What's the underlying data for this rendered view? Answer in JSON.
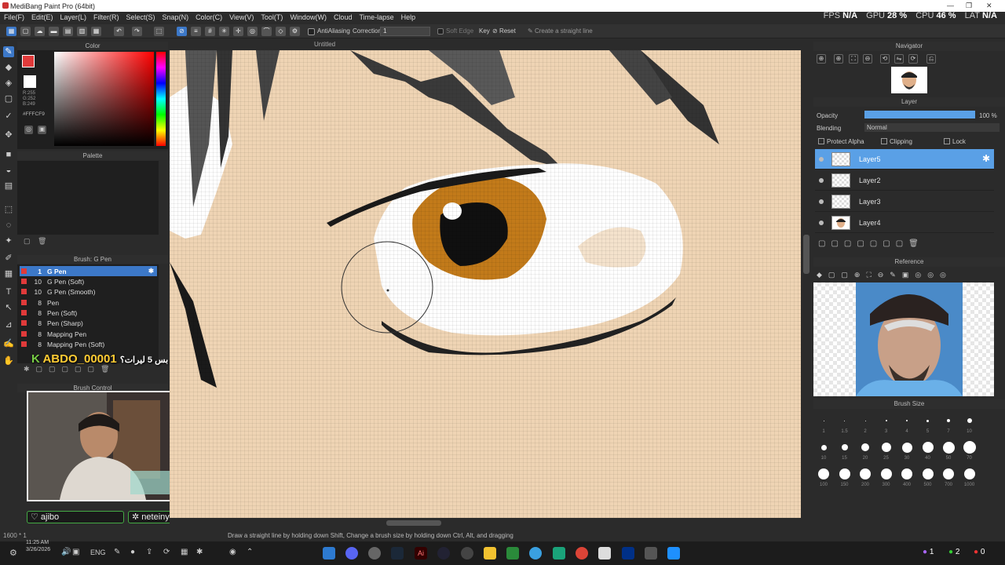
{
  "window": {
    "title": "MediBang Paint Pro (64bit)"
  },
  "menu": [
    "File(F)",
    "Edit(E)",
    "Layer(L)",
    "Filter(R)",
    "Select(S)",
    "Snap(N)",
    "Color(C)",
    "View(V)",
    "Tool(T)",
    "Window(W)",
    "Cloud",
    "Time-lapse",
    "Help"
  ],
  "perf": {
    "fps_label": "FPS",
    "fps": "N/A",
    "gpu_label": "GPU",
    "gpu": "28 %",
    "cpu_label": "CPU",
    "cpu": "46 %",
    "lat_label": "LAT",
    "lat": "N/A"
  },
  "toolbar": {
    "antialias": "AntiAliasing",
    "correction_label": "Correction",
    "correction_value": "1",
    "soft_edge": "Soft Edge",
    "key": "Key",
    "reset": "Reset",
    "straight": "Create a straight line"
  },
  "document": {
    "name": "Untitled"
  },
  "color_panel": {
    "title": "Color",
    "primary": "#e03a3a",
    "secondary": "#ffffff",
    "r": "R:255",
    "g": "G:252",
    "b": "B:249",
    "hex": "#FFFCF9"
  },
  "palette_panel": {
    "title": "Palette"
  },
  "brush_panel": {
    "title": "Brush: G Pen",
    "items": [
      {
        "size": "1",
        "name": "G Pen"
      },
      {
        "size": "10",
        "name": "G Pen (Soft)"
      },
      {
        "size": "10",
        "name": "G Pen (Smooth)"
      },
      {
        "size": "8",
        "name": "Pen"
      },
      {
        "size": "8",
        "name": "Pen (Soft)"
      },
      {
        "size": "8",
        "name": "Pen (Sharp)"
      },
      {
        "size": "8",
        "name": "Mapping Pen"
      },
      {
        "size": "8",
        "name": "Mapping Pen (Soft)"
      }
    ]
  },
  "brush_control": {
    "title": "Brush Control"
  },
  "navigator": {
    "title": "Navigator"
  },
  "layer_panel": {
    "title": "Layer",
    "opacity_label": "Opacity",
    "opacity_value": "100 %",
    "opacity": 1.0,
    "blending_label": "Blending",
    "blending_value": "Normal",
    "protect_alpha": "Protect Alpha",
    "clipping": "Clipping",
    "lock": "Lock",
    "layers": [
      "Layer5",
      "Layer2",
      "Layer3",
      "Layer4"
    ]
  },
  "reference_panel": {
    "title": "Reference"
  },
  "brush_size_panel": {
    "title": "Brush Size",
    "rows": [
      [
        "1",
        "1.5",
        "2",
        "3",
        "4",
        "5",
        "7",
        "10"
      ],
      [
        "10",
        "15",
        "20",
        "25",
        "30",
        "40",
        "50",
        "70"
      ],
      [
        "100",
        "150",
        "200",
        "300",
        "400",
        "500",
        "700",
        "1000"
      ]
    ]
  },
  "statusbar": {
    "size": "1600 * 1",
    "hint": "Draw a straight line by holding down Shift, Change a brush size by holding down Ctrl, Alt, and dragging"
  },
  "overlay": {
    "name": "ABDO_00001",
    "message": "بس 5 ليرات؟"
  },
  "tags": {
    "left": "ajibo",
    "right": "neteinyahu"
  },
  "taskbar": {
    "time": "11:25 AM",
    "date": "3/26/2026",
    "lang": "ENG",
    "badge1": "1",
    "badge2": "2",
    "badge3": "0"
  }
}
